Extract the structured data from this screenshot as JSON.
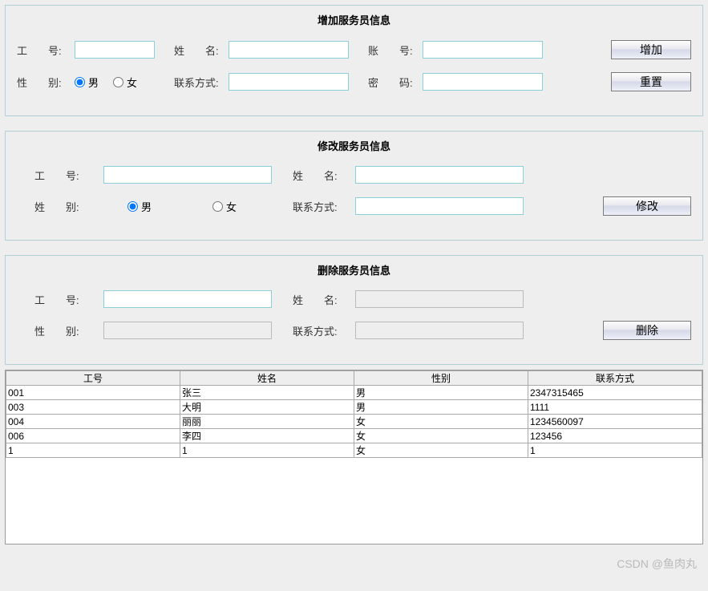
{
  "add": {
    "title": "增加服务员信息",
    "id_label": "工　　号:",
    "name_label": "姓　　名:",
    "account_label": "账　　号:",
    "gender_label": "性　　别:",
    "male": "男",
    "female": "女",
    "contact_label": "联系方式:",
    "password_label": "密　　码:",
    "add_btn": "增加",
    "reset_btn": "重置",
    "id_value": "",
    "name_value": "",
    "account_value": "",
    "contact_value": "",
    "password_value": "",
    "gender_selected": "male"
  },
  "edit": {
    "title": "修改服务员信息",
    "id_label": "工　　号:",
    "name_label": "姓　　名:",
    "gender_label": "姓　　别:",
    "male": "男",
    "female": "女",
    "contact_label": "联系方式:",
    "edit_btn": "修改",
    "id_value": "",
    "name_value": "",
    "contact_value": "",
    "gender_selected": "male"
  },
  "del": {
    "title": "删除服务员信息",
    "id_label": "工　　号:",
    "name_label": "姓　　名:",
    "gender_label": "性　　别:",
    "contact_label": "联系方式:",
    "del_btn": "删除",
    "id_value": "",
    "name_value": "",
    "gender_value": "",
    "contact_value": ""
  },
  "table": {
    "headers": [
      "工号",
      "姓名",
      "性别",
      "联系方式"
    ],
    "rows": [
      [
        "001",
        "张三",
        "男",
        "2347315465"
      ],
      [
        "003",
        "大明",
        "男",
        "1111"
      ],
      [
        "004",
        "丽丽",
        "女",
        "1234560097"
      ],
      [
        "006",
        "李四",
        "女",
        "123456"
      ],
      [
        "1",
        "1",
        "女",
        "1"
      ]
    ]
  },
  "watermark": "CSDN @鱼肉丸"
}
